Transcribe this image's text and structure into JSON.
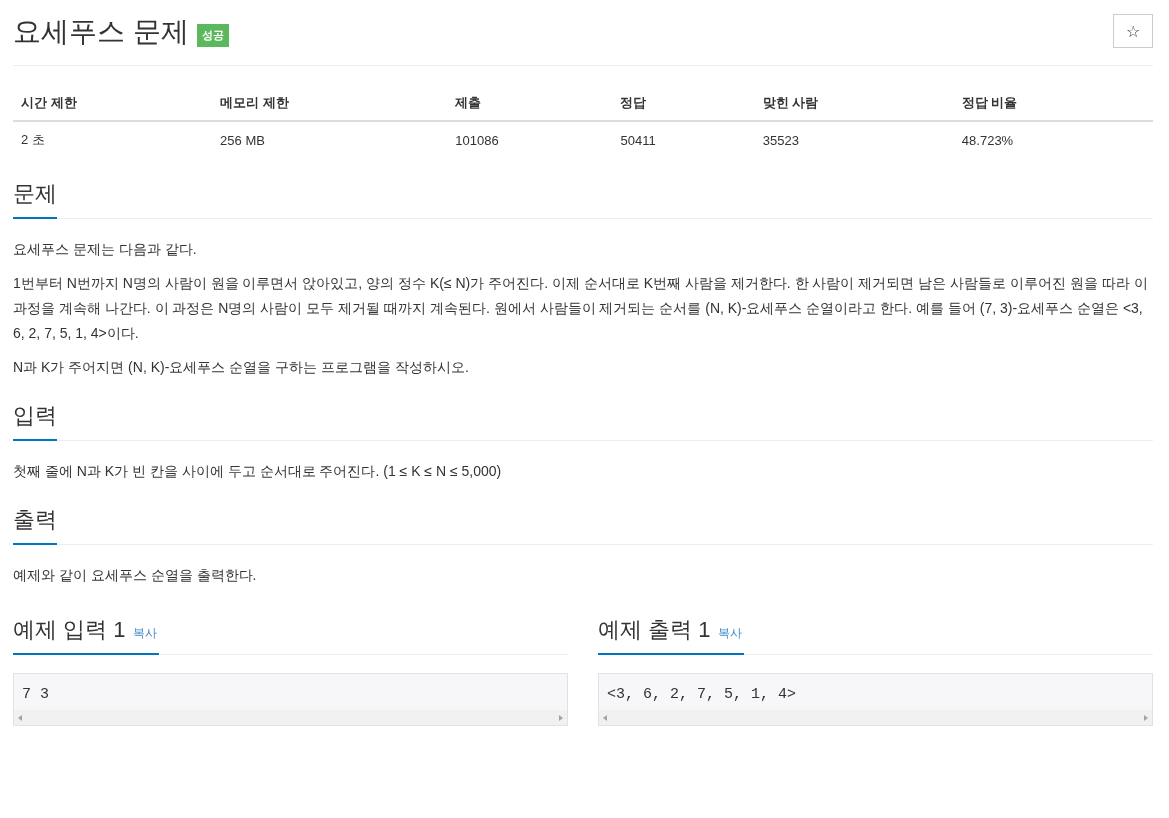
{
  "title": "요세푸스 문제",
  "badge": "성공",
  "star_button": "☆",
  "info_table": {
    "columns": [
      "시간 제한",
      "메모리 제한",
      "제출",
      "정답",
      "맞힌 사람",
      "정답 비율"
    ],
    "rows": [
      [
        "2 초",
        "256 MB",
        "101086",
        "50411",
        "35523",
        "48.723%"
      ]
    ]
  },
  "sections": [
    {
      "heading": "문제",
      "paragraphs": [
        "요세푸스 문제는 다음과 같다.",
        "1번부터 N번까지 N명의 사람이 원을 이루면서 앉아있고, 양의 정수 K(≤ N)가 주어진다. 이제 순서대로 K번째 사람을 제거한다. 한 사람이 제거되면 남은 사람들로 이루어진 원을 따라 이 과정을 계속해 나간다. 이 과정은 N명의 사람이 모두 제거될 때까지 계속된다. 원에서 사람들이 제거되는 순서를 (N, K)-요세푸스 순열이라고 한다. 예를 들어 (7, 3)-요세푸스 순열은 <3, 6, 2, 7, 5, 1, 4>이다.",
        "N과 K가 주어지면 (N, K)-요세푸스 순열을 구하는 프로그램을 작성하시오."
      ]
    },
    {
      "heading": "입력",
      "paragraphs": [
        "첫째 줄에 N과 K가 빈 칸을 사이에 두고 순서대로 주어진다. (1 ≤ K ≤ N ≤ 5,000)"
      ]
    },
    {
      "heading": "출력",
      "paragraphs": [
        "예제와 같이 요세푸스 순열을 출력한다."
      ]
    }
  ],
  "samples": [
    {
      "heading": "예제 입력 1",
      "copy": "복사",
      "code": "7 3"
    },
    {
      "heading": "예제 출력 1",
      "copy": "복사",
      "code": "<3, 6, 2, 7, 5, 1, 4>"
    }
  ]
}
